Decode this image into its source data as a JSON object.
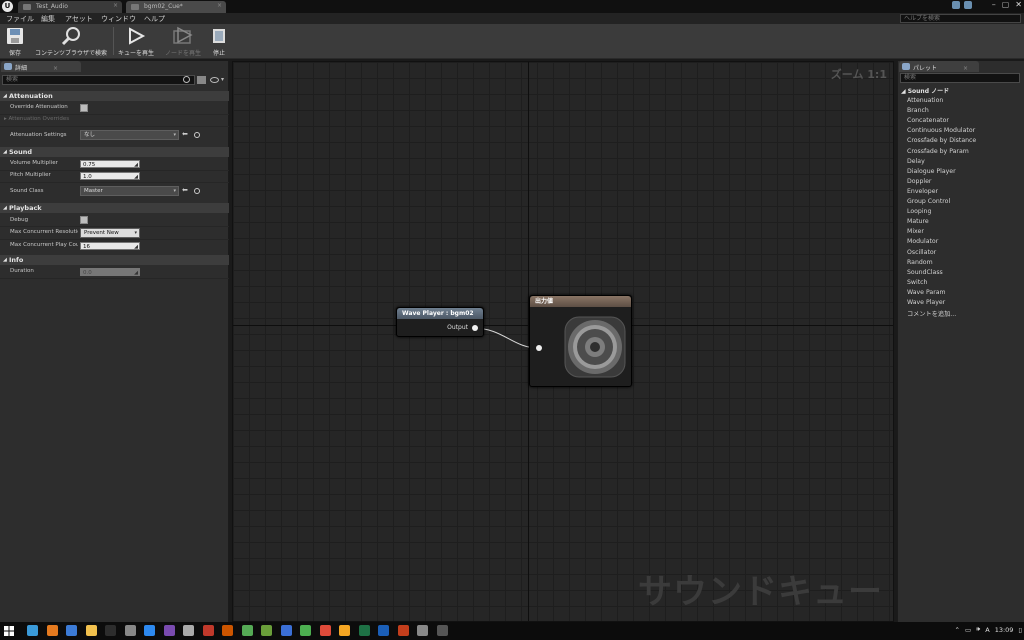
{
  "window": {
    "tabs": [
      "Test_Audio",
      "bgm02_Cue*"
    ]
  },
  "menu": {
    "items": [
      "ファイル",
      "編集",
      "アセット",
      "ウィンドウ",
      "ヘルプ"
    ],
    "help_search_placeholder": "ヘルプを検索"
  },
  "toolbar": {
    "buttons": [
      "保存",
      "コンテンツブラウザで検索",
      "キューを再生",
      "ノードを再生",
      "停止"
    ]
  },
  "details": {
    "tab_label": "詳細",
    "search_placeholder": "検索",
    "sections": {
      "attenuation": {
        "title": "Attenuation",
        "override_label": "Override Attenuation",
        "overrides_label": "Attenuation Overrides",
        "settings_label": "Attenuation Settings",
        "settings_value": "なし"
      },
      "sound": {
        "title": "Sound",
        "volume_label": "Volume Multiplier",
        "volume_value": "0.75",
        "pitch_label": "Pitch Multiplier",
        "pitch_value": "1.0",
        "class_label": "Sound Class",
        "class_value": "Master"
      },
      "playback": {
        "title": "Playback",
        "debug_label": "Debug",
        "resolution_label": "Max Concurrent Resolutio",
        "resolution_value": "Prevent New",
        "play_count_label": "Max Concurrent Play Cou",
        "play_count_value": "16"
      },
      "info": {
        "title": "Info",
        "duration_label": "Duration",
        "duration_value": "0.0"
      }
    }
  },
  "graph": {
    "zoom_label": "ズーム 1:1",
    "watermark": "サウンドキュー",
    "wave_node": {
      "title": "Wave Player : bgm02",
      "output_label": "Output"
    },
    "output_node": {
      "title": "出力値"
    }
  },
  "palette": {
    "tab_label": "パレット",
    "search_placeholder": "検索",
    "category": "Sound ノード",
    "items": [
      "Attenuation",
      "Branch",
      "Concatenator",
      "Continuous Modulator",
      "Crossfade by Distance",
      "Crossfade by Param",
      "Delay",
      "Dialogue Player",
      "Doppler",
      "Enveloper",
      "Group Control",
      "Looping",
      "Mature",
      "Mixer",
      "Modulator",
      "Oscillator",
      "Random",
      "SoundClass",
      "Switch",
      "Wave Param",
      "Wave Player",
      "コメントを追加..."
    ]
  },
  "taskbar": {
    "time": "13:09"
  },
  "colors": {
    "graph_bg": "#262626",
    "node_header": "#5b6774",
    "output_header": "#7a6758",
    "panel_bg": "#2d2d2d"
  }
}
